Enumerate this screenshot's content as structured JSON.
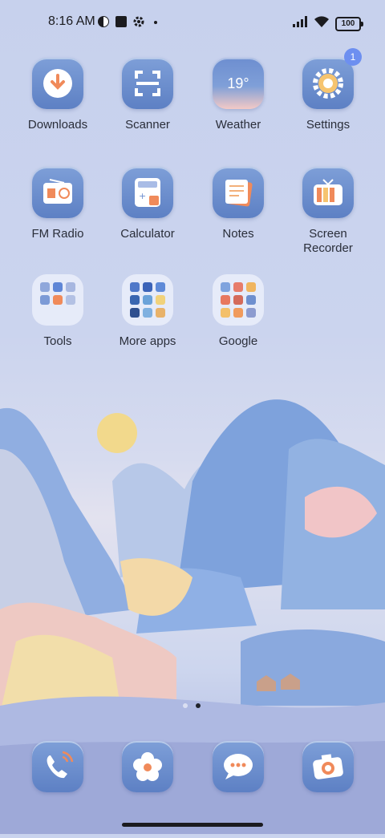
{
  "status_bar": {
    "time": "8:16 AM",
    "battery": "100",
    "icons": [
      "vpn-icon",
      "media-icon",
      "settings-gear-icon",
      "dot-icon",
      "signal-icon",
      "wifi-icon"
    ]
  },
  "apps_row1": [
    {
      "label": "Downloads",
      "icon": "download-arrow-icon"
    },
    {
      "label": "Scanner",
      "icon": "scanner-icon"
    },
    {
      "label": "Weather",
      "icon": "weather-icon",
      "tile_text": "19°"
    },
    {
      "label": "Settings",
      "icon": "gear-icon",
      "badge": "1"
    }
  ],
  "apps_row2": [
    {
      "label": "FM Radio",
      "icon": "radio-icon"
    },
    {
      "label": "Calculator",
      "icon": "calculator-icon"
    },
    {
      "label": "Notes",
      "icon": "notes-icon"
    },
    {
      "label": "Screen\nRecorder",
      "icon": "tv-icon"
    }
  ],
  "folders": [
    {
      "label": "Tools"
    },
    {
      "label": "More apps"
    },
    {
      "label": "Google"
    }
  ],
  "dock": [
    {
      "name": "phone",
      "icon": "phone-icon"
    },
    {
      "name": "gallery",
      "icon": "flower-icon"
    },
    {
      "name": "messages",
      "icon": "chat-bubble-icon"
    },
    {
      "name": "camera",
      "icon": "camera-icon"
    }
  ],
  "page_indicator": {
    "pages": 2,
    "current": 2
  },
  "colors": {
    "tile": "#6c8dcf",
    "accent": "#f08a5a",
    "badge": "#6d8ff0"
  }
}
